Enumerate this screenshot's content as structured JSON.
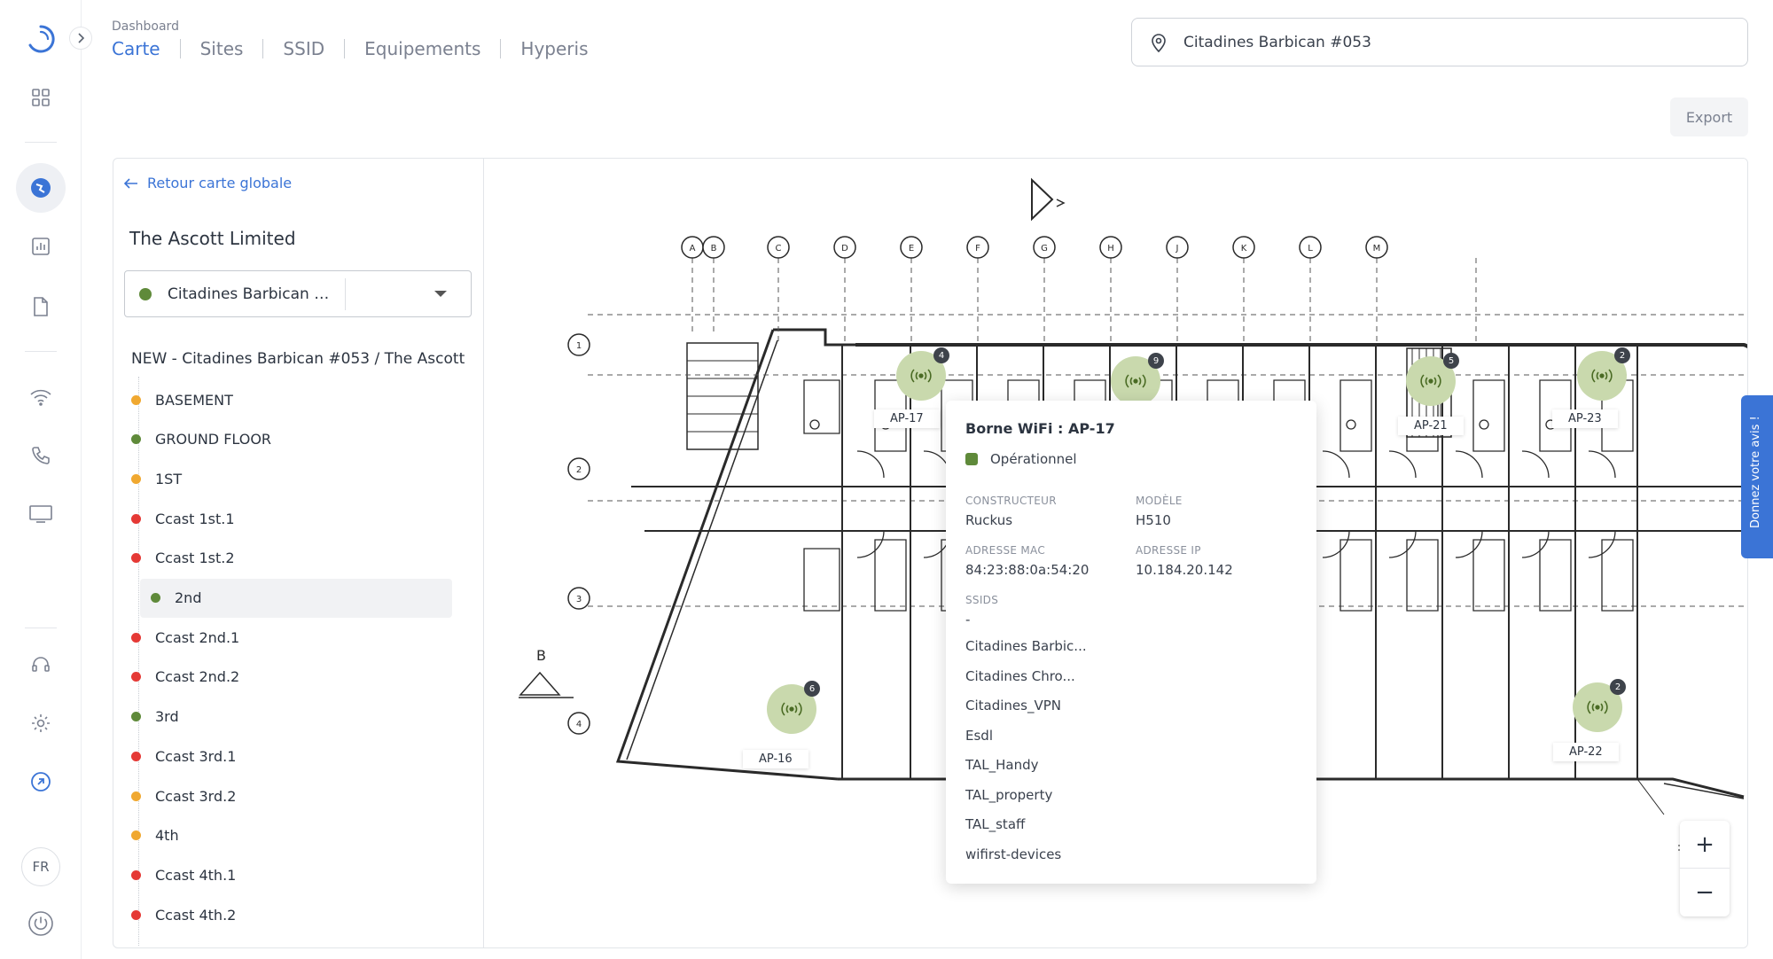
{
  "nav": {
    "breadcrumb": "Dashboard",
    "tabs": [
      {
        "label": "Carte",
        "active": true
      },
      {
        "label": "Sites",
        "active": false
      },
      {
        "label": "SSID",
        "active": false
      },
      {
        "label": "Equipements",
        "active": false
      },
      {
        "label": "Hyperis",
        "active": false
      }
    ]
  },
  "search": {
    "value": "Citadines Barbican #053"
  },
  "export_label": "Export",
  "sidebar": {
    "lang": "FR"
  },
  "panel": {
    "back_label": "Retour carte globale",
    "company": "The Ascott Limited",
    "selected_site": "Citadines Barbican #053",
    "site_title": "NEW - Citadines Barbican #053 / The Ascott",
    "floors": [
      {
        "label": "BASEMENT",
        "status": "orange"
      },
      {
        "label": "GROUND FLOOR",
        "status": "green"
      },
      {
        "label": "1ST",
        "status": "orange"
      },
      {
        "label": "Ccast 1st.1",
        "status": "red"
      },
      {
        "label": "Ccast 1st.2",
        "status": "red"
      },
      {
        "label": "2nd",
        "status": "green",
        "selected": true
      },
      {
        "label": "Ccast 2nd.1",
        "status": "red"
      },
      {
        "label": "Ccast 2nd.2",
        "status": "red"
      },
      {
        "label": "3rd",
        "status": "green"
      },
      {
        "label": "Ccast 3rd.1",
        "status": "red"
      },
      {
        "label": "Ccast 3rd.2",
        "status": "orange"
      },
      {
        "label": "4th",
        "status": "orange"
      },
      {
        "label": "Ccast 4th.1",
        "status": "red"
      },
      {
        "label": "Ccast 4th.2",
        "status": "red"
      }
    ]
  },
  "colors": {
    "green": "#5f8a3a",
    "orange": "#f0a830",
    "red": "#e53935",
    "accent": "#3b74d6"
  },
  "map": {
    "aps": [
      {
        "label": "AP-17",
        "count": "4"
      },
      {
        "label": "",
        "count": "9"
      },
      {
        "label": "AP-21",
        "count": "5"
      },
      {
        "label": "AP-23",
        "count": "2"
      },
      {
        "label": "AP-16",
        "count": "6"
      },
      {
        "label": "AP-22",
        "count": "2"
      }
    ],
    "grid_letters": [
      "A",
      "B",
      "C",
      "D",
      "E",
      "F",
      "G",
      "H",
      "J",
      "K",
      "L",
      "M"
    ],
    "grid_numbers": [
      "1",
      "2",
      "3",
      "4"
    ],
    "section_label": "B"
  },
  "popup": {
    "title": "Borne WiFi : AP-17",
    "status": "Opérationnel",
    "constructeur_label": "CONSTRUCTEUR",
    "constructeur": "Ruckus",
    "modele_label": "MODÈLE",
    "modele": "H510",
    "mac_label": "ADRESSE MAC",
    "mac": "84:23:88:0a:54:20",
    "ip_label": "ADRESSE IP",
    "ip": "10.184.20.142",
    "ssids_label": "SSIDS",
    "ssids_dash": "-",
    "ssids": [
      "Citadines Barbic...",
      "Citadines Chro...",
      "Citadines_VPN",
      "Esdl",
      "TAL_Handy",
      "TAL_property",
      "TAL_staff",
      "wifirst-devices"
    ]
  },
  "tools": {
    "info": "i",
    "zoom_in": "+",
    "zoom_out": "−"
  },
  "feedback_label": "Donnez votre avis !"
}
